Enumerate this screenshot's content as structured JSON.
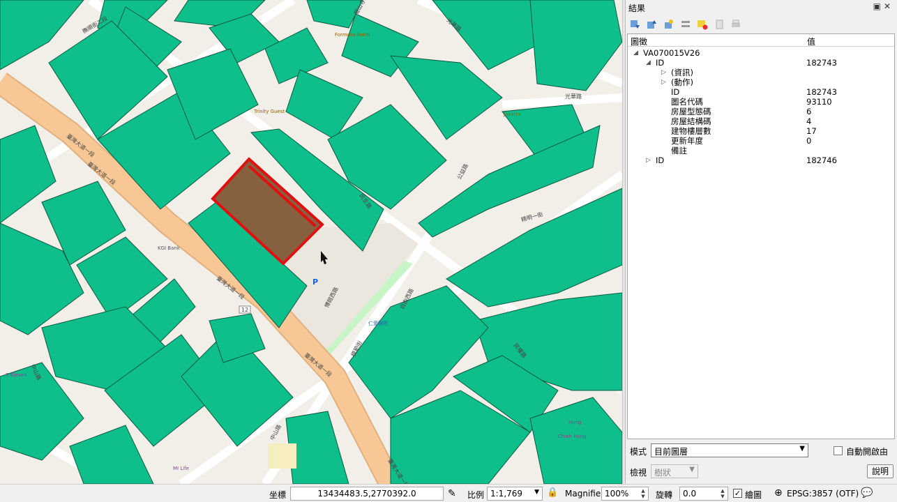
{
  "map": {
    "street_labels": {
      "road_top_left": "撫順街二段",
      "road_top_center": "龍山寺",
      "road_top_right": "光華路",
      "road_diag_upper": "臺灣大道一段",
      "road_diag_upper2": "臺灣大道一段",
      "road_diag_lower": "臺灣大道一段",
      "road_diag_lower2": "臺灣大道一段",
      "road_far_right": "光華路",
      "road_center": "民生路",
      "road_center2": "公益路",
      "road_vertical_mid": "博館西路",
      "road_vertical_low": "自由西路",
      "road_right_mid": "精明一街",
      "road_right_low": "民權路",
      "road_bottom": "模範街",
      "road_bottom_left": "中山路",
      "road_bottom_left2": "中山路",
      "road_bottom_right": "臺灣大道一段"
    },
    "poi": {
      "hotel": "Formosa Hotel",
      "cafe": "Trinity Guest",
      "kgi": "KGI Bank",
      "shop": "Jakarta",
      "bus_stop": "仁愛醫院",
      "parking": "P",
      "seven": "7-Eleven",
      "route": "12",
      "mitsuba": "MI Life",
      "hung": "Hung",
      "chiah": "Chiah Hung"
    }
  },
  "panel": {
    "title": "結果",
    "toolbar": [
      "expand-all",
      "collapse-all",
      "expand-new",
      "deselect",
      "clear",
      "copy",
      "print"
    ],
    "columns": {
      "feature": "圖徵",
      "value": "值"
    },
    "tree": {
      "layer": "VA070015V26",
      "rows": [
        {
          "key": "ID",
          "value": "182743",
          "level": 1,
          "arrow": "open"
        },
        {
          "key": "(資訊)",
          "value": "",
          "level": 2,
          "arrow": "closed"
        },
        {
          "key": "(動作)",
          "value": "",
          "level": 2,
          "arrow": "closed"
        },
        {
          "key": "ID",
          "value": "182743",
          "level": 2,
          "arrow": ""
        },
        {
          "key": "圖名代碼",
          "value": "93110",
          "level": 2,
          "arrow": ""
        },
        {
          "key": "房屋型態碼",
          "value": "6",
          "level": 2,
          "arrow": ""
        },
        {
          "key": "房屋結構碼",
          "value": "4",
          "level": 2,
          "arrow": ""
        },
        {
          "key": "建物樓層數",
          "value": "17",
          "level": 2,
          "arrow": ""
        },
        {
          "key": "更新年度",
          "value": "0",
          "level": 2,
          "arrow": ""
        },
        {
          "key": "備註",
          "value": "",
          "level": 2,
          "arrow": ""
        },
        {
          "key": "ID",
          "value": "182746",
          "level": 1,
          "arrow": "closed"
        }
      ]
    },
    "mode_label": "模式",
    "mode_value": "目前圖層",
    "auto_open_label": "自動開啟由",
    "view_label": "檢視",
    "view_value": "樹狀",
    "help_label": "說明"
  },
  "status": {
    "coord_label": "坐標",
    "coord_value": "13434483.5,2770392.0",
    "scale_label": "比例",
    "scale_value": "1:1,769",
    "magnifier_label": "Magnifier",
    "magnifier_value": "100%",
    "rotation_label": "旋轉",
    "rotation_value": "0.0",
    "render_label": "繪圖",
    "crs_label": "EPSG:3857 (OTF)"
  },
  "colors": {
    "building": "#0fbf8b",
    "road_major": "#f7c895",
    "selection": "#e01010",
    "selected_fill": "#87603f",
    "park": "#c8f5c8",
    "map_bg": "#f2efe9"
  }
}
